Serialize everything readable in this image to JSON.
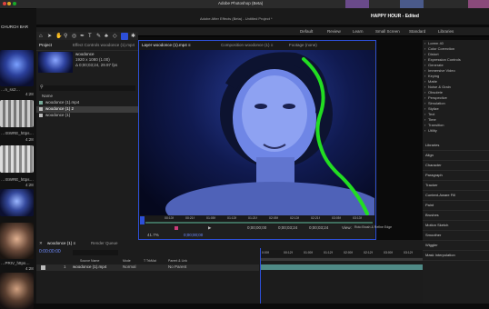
{
  "top": {
    "ps_title": "Adobe Photoshop (Beta)",
    "ae_title": "Adobe After Effects (Beta) - Untitled Project *",
    "banner": "HAPPY HOUR - Edited"
  },
  "chat": {
    "header": "CHURCH BAR",
    "items": [
      {
        "name": "…n_ss2…",
        "time": "4:28"
      },
      {
        "name": "…ISWRE_https…",
        "time": "4:28"
      },
      {
        "name": "…ISWRE_https…",
        "time": "4:28"
      },
      {
        "name": "…PRIV_https…",
        "time": "4:28"
      }
    ]
  },
  "workspace": {
    "items": [
      "Default",
      "Review",
      "Learn",
      "Small Screen",
      "Standard",
      "Libraries"
    ]
  },
  "project": {
    "tab_project": "Project",
    "tab_effects": "Effect Controls woodonce (1).mp4",
    "clip_name": "woodonce",
    "clip_info1": "1920 x 1080 (1.00)",
    "clip_info2": "Δ 0;00;03;24, 29.97 fps",
    "search_placeholder": "",
    "list_header": "Name",
    "files": [
      "woodonce (1).mp4",
      "woodonce (1) 2",
      "woodonce (1)"
    ]
  },
  "viewer": {
    "tab_layer": "Layer woodonce (1).mp4 ≡",
    "tab_comp": "Composition woodonce (1) ≡",
    "tab_footage": "Footage (none)",
    "ruler": [
      "00:13f",
      "00:21f",
      "01:05f",
      "01:13f",
      "01:21f",
      "02:05f",
      "02:13f",
      "02:21f",
      "03:05f",
      "03:13f",
      "03:21f"
    ],
    "time_a": "0;00;00;00",
    "time_b": "0;00;03;24",
    "time_c": "0;00;03;24",
    "view_label": "View:",
    "view_value": "Roto Brush & Refine Edge",
    "render_label": "Render",
    "zoom": "41.7%",
    "timecode": "0;00;00;00"
  },
  "right": {
    "items": [
      "Lorem 40",
      "Color Correction",
      "Distort",
      "Expression Controls",
      "Generate",
      "Immersive Video",
      "Keying",
      "Matte",
      "Noise & Grain",
      "Obsolete",
      "Perspective",
      "Simulation",
      "Stylize",
      "Text",
      "Time",
      "Transition",
      "Utility"
    ],
    "panels": [
      "Libraries",
      "Align",
      "Character",
      "Paragraph",
      "Tracker",
      "Content-Aware Fill",
      "Paint",
      "Brushes",
      "Motion Sketch",
      "Smoother",
      "Wiggler",
      "Mask Interpolation"
    ]
  },
  "timeline": {
    "tab": "woodonce (1) ≡",
    "render_queue": "Render Queue",
    "timecode": "0:00:00:00",
    "col_source": "Source Name",
    "col_mode": "Mode",
    "col_trkmat": "T TrkMat",
    "col_parent": "Parent & Link",
    "layer_num": "1",
    "layer_name": "woodonce (1).mp4",
    "layer_mode": "Normal",
    "layer_parent": "No Parent",
    "ticks": [
      "0:00f",
      "00:12f",
      "01:00f",
      "01:12f",
      "02:00f",
      "02:12f",
      "03:00f",
      "03:12f"
    ]
  },
  "colors": {
    "accent": "#2d4fd8",
    "roto": "#22dd22",
    "clip": "#4f8a86"
  }
}
